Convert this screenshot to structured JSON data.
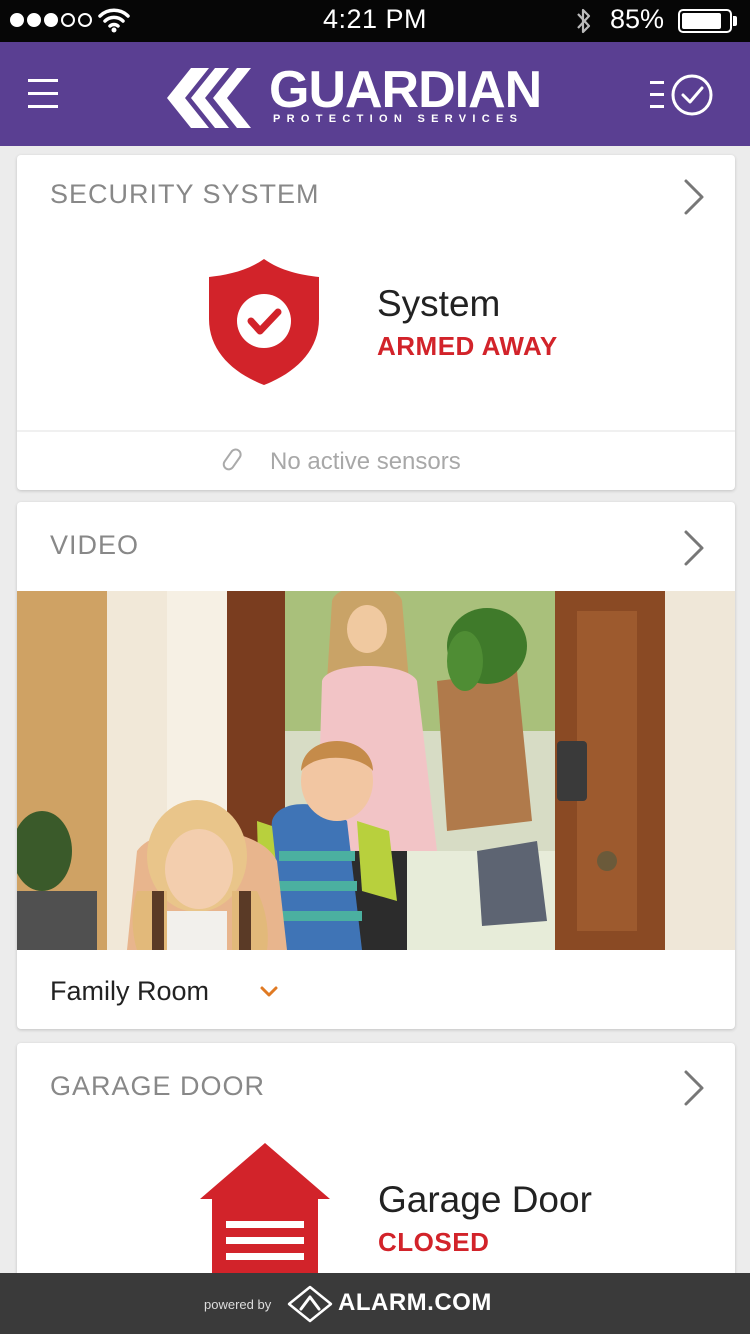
{
  "status_bar": {
    "time": "4:21 PM",
    "battery_percent": "85%",
    "battery_level": 0.85,
    "signal_bars_filled": 3,
    "signal_bars_total": 5
  },
  "header": {
    "brand_name": "GUARDIAN",
    "brand_tagline": "PROTECTION SERVICES",
    "background_color": "#5a3f92"
  },
  "security": {
    "title": "SECURITY SYSTEM",
    "status_name": "System",
    "status_value": "ARMED AWAY",
    "sensors_text": "No active sensors",
    "accent_color": "#d2232a"
  },
  "video": {
    "title": "VIDEO",
    "camera_name": "Family Room"
  },
  "garage": {
    "title": "GARAGE DOOR",
    "device_name": "Garage Door",
    "device_status": "CLOSED"
  },
  "footer": {
    "powered_by": "powered by",
    "provider": "ALARM.COM"
  },
  "icons": {
    "menu": "hamburger-icon",
    "history": "history-clock-icon",
    "shield": "shield-check-icon",
    "sensor": "sensor-icon",
    "garage": "garage-icon",
    "chevron": "chevron-right-icon",
    "dropdown": "chevron-down-icon"
  }
}
